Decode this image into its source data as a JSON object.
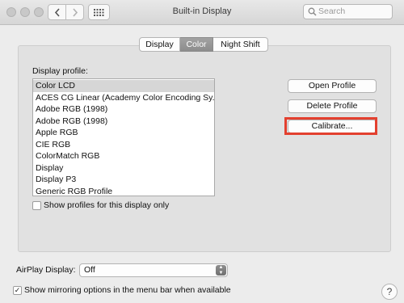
{
  "window": {
    "title": "Built-in Display",
    "search_placeholder": "Search"
  },
  "tabs": [
    {
      "label": "Display",
      "selected": false
    },
    {
      "label": "Color",
      "selected": true
    },
    {
      "label": "Night Shift",
      "selected": false
    }
  ],
  "color_tab": {
    "profile_label": "Display profile:",
    "profiles": [
      "Color LCD",
      "ACES CG Linear (Academy Color Encoding Sy...",
      "Adobe RGB (1998)",
      "Adobe RGB (1998)",
      "Apple RGB",
      "CIE RGB",
      "ColorMatch RGB",
      "Display",
      "Display P3",
      "Generic RGB Profile"
    ],
    "selected_profile": "Color LCD",
    "buttons": {
      "open": "Open Profile",
      "delete": "Delete Profile",
      "calibrate": "Calibrate..."
    },
    "show_profiles_checkbox": {
      "label": "Show profiles for this display only",
      "checked": false
    }
  },
  "airplay": {
    "label": "AirPlay Display:",
    "value": "Off"
  },
  "mirroring_checkbox": {
    "label": "Show mirroring options in the menu bar when available",
    "checked": true
  },
  "help_glyph": "?",
  "colors": {
    "highlight": "#e3402f",
    "selected_tab": "#8c8c8c"
  }
}
